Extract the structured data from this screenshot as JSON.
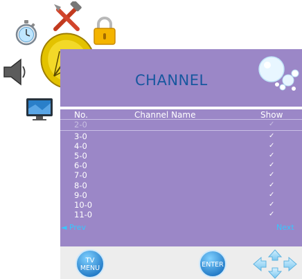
{
  "menu": {
    "icons": [
      "stopwatch-icon",
      "tools-icon",
      "lock-icon",
      "speaker-icon",
      "satellite-dish-icon",
      "monitor-icon"
    ]
  },
  "panel": {
    "title": "CHANNEL",
    "columns": {
      "no": "No.",
      "name": "Channel Name",
      "show": "Show"
    },
    "rows": [
      {
        "no": "2-0",
        "show": "✓"
      },
      {
        "no": "3-0",
        "show": "✓"
      },
      {
        "no": "4-0",
        "show": "✓"
      },
      {
        "no": "5-0",
        "show": "✓"
      },
      {
        "no": "6-0",
        "show": "✓"
      },
      {
        "no": "7-0",
        "show": "✓"
      },
      {
        "no": "8-0",
        "show": "✓"
      },
      {
        "no": "9-0",
        "show": "✓"
      },
      {
        "no": "10-0",
        "show": "✓"
      },
      {
        "no": "11-0",
        "show": "✓"
      }
    ],
    "prev_label": "◄ Prev",
    "next_label": "Next"
  },
  "footer": {
    "menu_label_line1": "TV",
    "menu_label_line2": "MENU",
    "enter_label": "ENTER"
  },
  "colors": {
    "panel": "#9b87c7",
    "title": "#17579e",
    "nav_link": "#35c8ff",
    "button": "#2c8fd6"
  }
}
